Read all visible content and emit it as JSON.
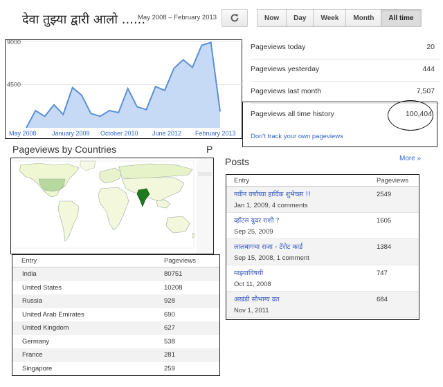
{
  "header": {
    "blog_title": "देवा तुझ्या द्वारी आलो ......",
    "date_range": "May 2008 – February 2013",
    "refresh_icon": "refresh-icon",
    "range_buttons": [
      "Now",
      "Day",
      "Week",
      "Month",
      "All time"
    ],
    "active_range": "All time"
  },
  "chart_data": {
    "type": "area",
    "x": [
      "2008-05",
      "2008-08",
      "2008-11",
      "2009-02",
      "2009-05",
      "2009-08",
      "2009-11",
      "2010-02",
      "2010-05",
      "2010-08",
      "2010-11",
      "2011-02",
      "2011-05",
      "2011-08",
      "2011-11",
      "2012-02",
      "2012-05",
      "2012-08",
      "2012-11",
      "2013-02"
    ],
    "values": [
      0,
      1800,
      1200,
      2400,
      1400,
      4200,
      3400,
      1500,
      1200,
      1800,
      1600,
      4100,
      2200,
      1900,
      4300,
      3900,
      6200,
      7100,
      6300,
      8600,
      8900,
      1700
    ],
    "x_tick_labels": [
      "May 2008",
      "January 2009",
      "October 2010",
      "June 2012",
      "February 2013"
    ],
    "y_tick_labels": [
      "9000",
      "4500"
    ],
    "ylim": [
      0,
      9000
    ],
    "fill_color": "#c6daf5",
    "line_color": "#5b8fd6"
  },
  "stats": {
    "today_label": "Pageviews today",
    "today_value": "20",
    "yesterday_label": "Pageviews yesterday",
    "yesterday_value": "444",
    "last_month_label": "Pageviews last month",
    "last_month_value": "7,507",
    "all_time_label": "Pageviews all time history",
    "all_time_value": "100,404",
    "dont_track": "Don't track your own pageviews"
  },
  "countries": {
    "title": "Pageviews by Countries",
    "overflow_letter": "P",
    "col_entry": "Entry",
    "col_pageviews": "Pageviews",
    "rows": [
      {
        "name": "India",
        "pageviews": "80751"
      },
      {
        "name": "United States",
        "pageviews": "10208"
      },
      {
        "name": "Russia",
        "pageviews": "928"
      },
      {
        "name": "United Arab Emirates",
        "pageviews": "690"
      },
      {
        "name": "United Kingdom",
        "pageviews": "627"
      },
      {
        "name": "Germany",
        "pageviews": "538"
      },
      {
        "name": "France",
        "pageviews": "281"
      },
      {
        "name": "Singapore",
        "pageviews": "259"
      }
    ],
    "map_highlight_color": "#1e7a1e",
    "map_light_color": "#f0f7d6"
  },
  "posts": {
    "title": "Posts",
    "more_link": "More »",
    "col_entry": "Entry",
    "col_pageviews": "Pageviews",
    "rows": [
      {
        "title": "नवीन वर्षाच्या हार्दिक शुभेच्छा !!",
        "meta": "Jan 1, 2009, 4 comments",
        "pageviews": "2549"
      },
      {
        "title": "व्हॉटस युवर राशी ?",
        "meta": "Sep 25, 2009",
        "pageviews": "1605"
      },
      {
        "title": "लालबागचा राजा - टॅरोट कार्ड",
        "meta": "Sep 15, 2008, 1 comment",
        "pageviews": "1384"
      },
      {
        "title": "माझ्याविषयी",
        "meta": "Oct 11, 2008",
        "pageviews": "747"
      },
      {
        "title": "अखंडी सौभाग्य व्रत",
        "meta": "Nov 1, 2011",
        "pageviews": "684"
      }
    ]
  }
}
